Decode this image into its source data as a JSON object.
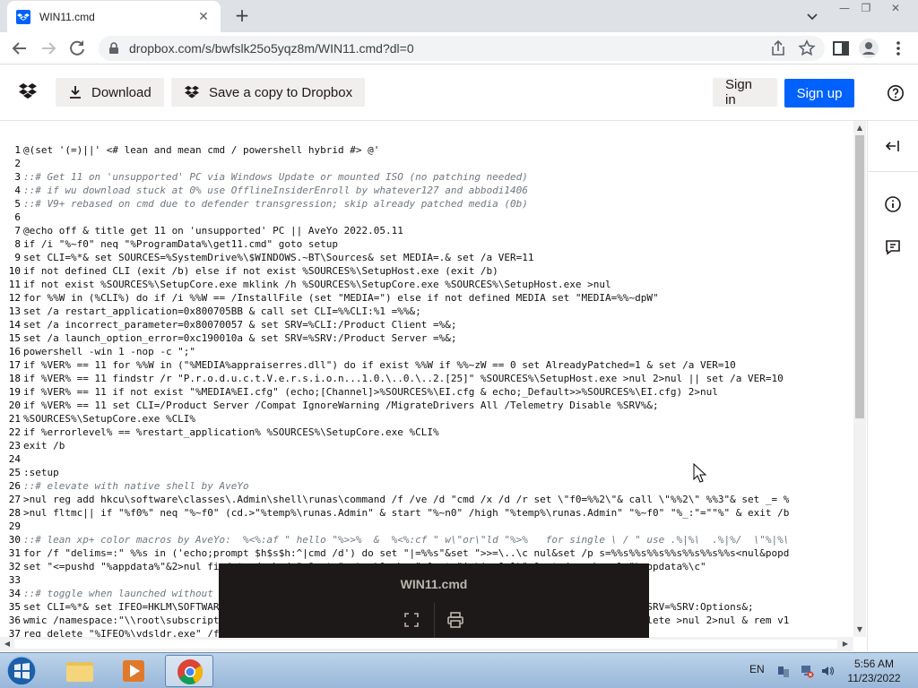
{
  "browser": {
    "tab_title": "WIN11.cmd",
    "tab_close": "✕",
    "new_tab": "+",
    "url": "dropbox.com/s/bwfslk25o5yqz8m/WIN11.cmd?dl=0",
    "window_controls": {
      "minimize": "—",
      "restore": "❐",
      "close": "✕"
    }
  },
  "dropbox": {
    "download_label": "Download",
    "save_copy_label": "Save a copy to Dropbox",
    "sign_in_label": "Sign in",
    "sign_up_label": "Sign up",
    "accent_color": "#0061fe"
  },
  "code_lines": [
    {
      "n": "1",
      "t": "@(set '(=)||' <# lean and mean cmd / powershell hybrid #> @'",
      "k": "plain"
    },
    {
      "n": "2",
      "t": "",
      "k": "plain"
    },
    {
      "n": "3",
      "t": "::# Get 11 on 'unsupported' PC via Windows Update or mounted ISO (no patching needed)",
      "k": "comment"
    },
    {
      "n": "4",
      "t": "::# if wu download stuck at 0% use OfflineInsiderEnroll by whatever127 and abbodi1406",
      "k": "comment"
    },
    {
      "n": "5",
      "t": "::# V9+ rebased on cmd due to defender transgression; skip already patched media (0b)",
      "k": "comment"
    },
    {
      "n": "6",
      "t": "",
      "k": "plain"
    },
    {
      "n": "7",
      "t": "@echo off & title get 11 on 'unsupported' PC || AveYo 2022.05.11",
      "k": "plain"
    },
    {
      "n": "8",
      "t": "if /i \"%~f0\" neq \"%ProgramData%\\get11.cmd\" goto setup",
      "k": "plain"
    },
    {
      "n": "9",
      "t": "set CLI=%*& set SOURCES=%SystemDrive%\\$WINDOWS.~BT\\Sources& set MEDIA=.& set /a VER=11",
      "k": "plain"
    },
    {
      "n": "10",
      "t": "if not defined CLI (exit /b) else if not exist %SOURCES%\\SetupHost.exe (exit /b)",
      "k": "plain"
    },
    {
      "n": "11",
      "t": "if not exist %SOURCES%\\SetupCore.exe mklink /h %SOURCES%\\SetupCore.exe %SOURCES%\\SetupHost.exe >nul",
      "k": "plain"
    },
    {
      "n": "12",
      "t": "for %%W in (%CLI%) do if /i %%W == /InstallFile (set \"MEDIA=\") else if not defined MEDIA set \"MEDIA=%%~dpW\"",
      "k": "plain"
    },
    {
      "n": "13",
      "t": "set /a restart_application=0x800705BB & call set CLI=%%CLI:%1 =%%&;",
      "k": "plain"
    },
    {
      "n": "14",
      "t": "set /a incorrect_parameter=0x80070057 & set SRV=%CLI:/Product Client =%&;",
      "k": "plain"
    },
    {
      "n": "15",
      "t": "set /a launch_option_error=0xc190010a & set SRV=%SRV:/Product Server =%&;",
      "k": "plain"
    },
    {
      "n": "16",
      "t": "powershell -win 1 -nop -c \";\"",
      "k": "plain"
    },
    {
      "n": "17",
      "t": "if %VER% == 11 for %%W in (\"%MEDIA%appraiserres.dll\") do if exist %%W if %%~zW == 0 set AlreadyPatched=1 & set /a VER=10",
      "k": "plain"
    },
    {
      "n": "18",
      "t": "if %VER% == 11 findstr /r \"P.r.o.d.u.c.t.V.e.r.s.i.o.n...1.0.\\..0.\\..2.[25]\" %SOURCES%\\SetupHost.exe >nul 2>nul || set /a VER=10",
      "k": "plain"
    },
    {
      "n": "19",
      "t": "if %VER% == 11 if not exist \"%MEDIA%EI.cfg\" (echo;[Channel]>%SOURCES%\\EI.cfg & echo;_Default>>%SOURCES%\\EI.cfg) 2>nul",
      "k": "plain"
    },
    {
      "n": "20",
      "t": "if %VER% == 11 set CLI=/Product Server /Compat IgnoreWarning /MigrateDrivers All /Telemetry Disable %SRV%&;",
      "k": "plain"
    },
    {
      "n": "21",
      "t": "%SOURCES%\\SetupCore.exe %CLI%",
      "k": "plain"
    },
    {
      "n": "22",
      "t": "if %errorlevel% == %restart_application% %SOURCES%\\SetupCore.exe %CLI%",
      "k": "plain"
    },
    {
      "n": "23",
      "t": "exit /b",
      "k": "plain"
    },
    {
      "n": "24",
      "t": "",
      "k": "plain"
    },
    {
      "n": "25",
      "t": ":setup",
      "k": "plain"
    },
    {
      "n": "26",
      "t": "::# elevate with native shell by AveYo",
      "k": "comment"
    },
    {
      "n": "27",
      "t": ">nul reg add hkcu\\software\\classes\\.Admin\\shell\\runas\\command /f /ve /d \"cmd /x /d /r set \\\"f0=%%2\\\"& call \\\"%%2\\\" %%3\"& set _= %",
      "k": "plain"
    },
    {
      "n": "28",
      "t": ">nul fltmc|| if \"%f0%\" neq \"%~f0\" (cd.>\"%temp%\\runas.Admin\" & start \"%~n0\" /high \"%temp%\\runas.Admin\" \"%~f0\" \"%_:\"=\"\"%\" & exit /b",
      "k": "plain"
    },
    {
      "n": "29",
      "t": "",
      "k": "plain"
    },
    {
      "n": "30",
      "t": "::# lean xp+ color macros by AveYo:  %<%:af \" hello \"%>>%  &  %<%:cf \" w\\\"or\\\"ld \"%>%   for single \\ / \" use .%|%\\  .%|%/  \\\"%|%\\",
      "k": "comment"
    },
    {
      "n": "31",
      "t": "for /f \"delims=:\" %%s in ('echo;prompt $h$s$h:^|cmd /d') do set \"|=%%s\"&set \">>=\\..\\c nul&set /p s=%%s%%s%%s%%s%%s%%s%%s<nul&popd",
      "k": "plain"
    },
    {
      "n": "32",
      "t": "set \"<=pushd \"%appdata%\"&2>nul findstr /c:\\ /a\" &set \">=%>>%&echo;\" &set \"|=%|:~0,1%\" &set /p s=\\<nul>\"%appdata%\\c\"",
      "k": "plain"
    },
    {
      "n": "33",
      "t": "",
      "k": "plain"
    },
    {
      "n": "34",
      "t": "::# toggle when launched without arguments, else jump to arguments: \"install\" or \"remove\"",
      "k": "comment"
    },
    {
      "n": "35",
      "t": "set CLI=%*& set IFEO=HKLM\\SOFTWARE\\Microsoft\\Windows NT\\CurrentVersion\\Image File Execution Options& set SRV=%SRV:Options&;",
      "k": "plain"
    },
    {
      "n": "36",
      "t": "wmic /namespace:\"\\\\root\\subscription\" path __EventFilter where Name=\"Skip TPM Check on Dynamic Update\" delete >nul 2>nul & rem v1",
      "k": "plain"
    },
    {
      "n": "37",
      "t": "reg delete \"%IFEO%\\vdsldr.exe\" /f 2>nul & rem v1 - v5",
      "k": "plain"
    }
  ],
  "overlay": {
    "title": "WIN11.cmd"
  },
  "taskbar": {
    "language": "EN",
    "time": "5:56 AM",
    "date": "11/23/2022"
  }
}
